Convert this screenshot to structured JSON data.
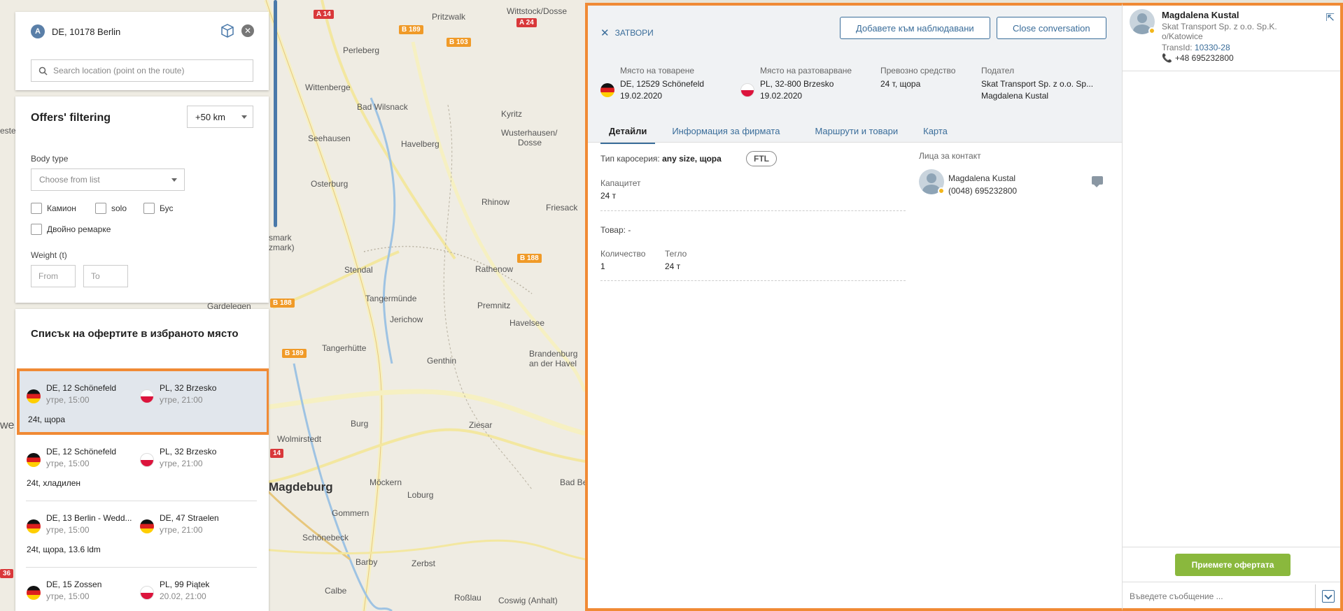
{
  "location": {
    "badge": "A",
    "text": "DE, 10178 Berlin",
    "search_placeholder": "Search location (point on the route)"
  },
  "filter": {
    "title": "Offers' filtering",
    "radius": "+50 km",
    "body_type_label": "Body type",
    "body_type_placeholder": "Choose from list",
    "checkboxes": [
      "Камион",
      "solo",
      "Бус",
      "Двойно ремарке"
    ],
    "weight_label": "Weight (t)",
    "weight_from_placeholder": "From",
    "weight_to_placeholder": "To"
  },
  "offers": {
    "title": "Списък на офертите в избраното място",
    "items": [
      {
        "from_city": "DE, 12 Schönefeld",
        "from_time": "утре, 15:00",
        "to_city": "PL, 32 Brzesko",
        "to_time": "утре, 21:00",
        "desc": "24t, щора"
      },
      {
        "from_city": "DE, 12 Schönefeld",
        "from_time": "утре, 15:00",
        "to_city": "PL, 32 Brzesko",
        "to_time": "утре, 21:00",
        "desc": "24t, хладилен"
      },
      {
        "from_city": "DE, 13 Berlin - Wedd...",
        "from_time": "утре, 15:00",
        "to_city": "DE, 47 Straelen",
        "to_time": "утре, 21:00",
        "desc": "24t, щора, 13.6 ldm"
      },
      {
        "from_city": "DE, 15 Zossen",
        "from_time": "утре, 15:00",
        "to_city": "PL, 99 Piątek",
        "to_time": "20.02, 21:00",
        "desc": ""
      }
    ]
  },
  "map": {
    "labels": [
      "Pritzwalk",
      "Wittstock/Dosse",
      "Perleberg",
      "Wittenberge",
      "Bad Wilsnack",
      "Kyritz",
      "Wusterhausen/",
      "Dosse",
      "Seehausen",
      "Havelberg",
      "Osterburg",
      "Rhinow",
      "Friesack",
      "Stendal",
      "Rathenow",
      "Tangermünde",
      "Jerichow",
      "Premnitz",
      "Havelsee",
      "Tangerhütte",
      "Brandenburg",
      "an der Havel",
      "Genthin",
      "Burg",
      "Ziesar",
      "Wolmirstedt",
      "Magdeburg",
      "Möckern",
      "Loburg",
      "Bad Belzig",
      "Gommern",
      "Schönebeck",
      "Barby",
      "Zerbst",
      "Calbe",
      "Roßlau",
      "Coswig (Anhalt)",
      "Gardelegen",
      "smark",
      "zmark)",
      "este",
      "we"
    ],
    "roads": [
      "A 14",
      "B 189",
      "B 103",
      "A 24",
      "B 188",
      "B 189",
      "B 188",
      "14",
      "188",
      "36"
    ]
  },
  "detail": {
    "close_label": "ЗАТВОРИ",
    "watch_button": "Добавете към наблюдавани",
    "close_conversation_button": "Close conversation",
    "loading_label": "Място на товарене",
    "loading_place": "DE, 12529 Schönefeld",
    "loading_date": "19.02.2020",
    "unloading_label": "Място на разтоварване",
    "unloading_place": "PL, 32-800 Brzesko",
    "unloading_date": "19.02.2020",
    "vehicle_label": "Превозно средство",
    "vehicle_value": "24 т, щора",
    "sender_label": "Подател",
    "sender_company": "Skat Transport Sp. z o.o. Sp...",
    "sender_person": "Magdalena Kustal",
    "tabs": [
      "Детайли",
      "Информация за фирмата",
      "Маршрути и товари",
      "Карта"
    ],
    "body_type_label": "Тип каросерия:",
    "body_type_value": "any size, щора",
    "ftl": "FTL",
    "capacity_label": "Капацитет",
    "capacity_value": "24 т",
    "goods_label": "Товар:",
    "goods_value": "-",
    "quantity_label": "Количество",
    "quantity_value": "1",
    "weight_label": "Тегло",
    "weight_value": "24 т",
    "contacts_label": "Лица за контакт",
    "contact_name": "Magdalena Kustal",
    "contact_phone": "(0048) 695232800"
  },
  "chat": {
    "name": "Magdalena Kustal",
    "company": "Skat Transport Sp. z o.o. Sp.K. o/Katowice",
    "trans_label": "TransId:",
    "trans_id": "10330-28",
    "phone": "+48 695232800",
    "accept_button": "Приемете офертата",
    "message_placeholder": "Въведете съобщение ..."
  },
  "colors": {
    "accent_orange": "#f08a35",
    "link_blue": "#3a6d9a",
    "accept_green": "#8ab83d",
    "status_yellow": "#f2b61b"
  }
}
